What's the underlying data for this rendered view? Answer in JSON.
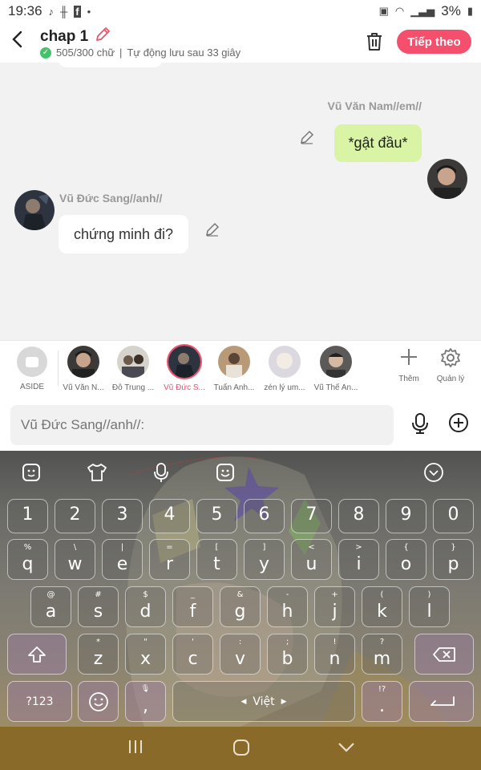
{
  "status_bar": {
    "time": "19:36",
    "battery": "3%"
  },
  "header": {
    "title": "chap 1",
    "word_count": "505/300 chữ",
    "separator": "|",
    "autosave": "Tự động lưu sau 33 giây",
    "next_label": "Tiếp theo"
  },
  "messages": [
    {
      "speaker": "Vũ Văn Nam//em//",
      "text": "*gật đầu*",
      "side": "right"
    },
    {
      "speaker": "Vũ Đức Sang//anh//",
      "text": "chứng minh đi?",
      "side": "left"
    }
  ],
  "characters": [
    {
      "label": "ASIDE"
    },
    {
      "label": "Vũ Văn N..."
    },
    {
      "label": "Đỗ Trung ..."
    },
    {
      "label": "Vũ Đức S...",
      "selected": true
    },
    {
      "label": "Tuấn Anh..."
    },
    {
      "label": "zén lý um..."
    },
    {
      "label": "Vũ Thế An..."
    }
  ],
  "tools": {
    "add_label": "Thêm",
    "manage_label": "Quản lý"
  },
  "input": {
    "placeholder": "Vũ Đức Sang//anh//:"
  },
  "keyboard": {
    "number_row": [
      "1",
      "2",
      "3",
      "4",
      "5",
      "6",
      "7",
      "8",
      "9",
      "0"
    ],
    "row1": [
      {
        "k": "q",
        "s": "%"
      },
      {
        "k": "w",
        "s": "\\"
      },
      {
        "k": "e",
        "s": "|"
      },
      {
        "k": "r",
        "s": "="
      },
      {
        "k": "t",
        "s": "["
      },
      {
        "k": "y",
        "s": "]"
      },
      {
        "k": "u",
        "s": "<"
      },
      {
        "k": "i",
        "s": ">"
      },
      {
        "k": "o",
        "s": "{"
      },
      {
        "k": "p",
        "s": "}"
      }
    ],
    "row2": [
      {
        "k": "a",
        "s": "@"
      },
      {
        "k": "s",
        "s": "#"
      },
      {
        "k": "d",
        "s": "$"
      },
      {
        "k": "f",
        "s": "_"
      },
      {
        "k": "g",
        "s": "&"
      },
      {
        "k": "h",
        "s": "-"
      },
      {
        "k": "j",
        "s": "+"
      },
      {
        "k": "k",
        "s": "("
      },
      {
        "k": "l",
        "s": ")"
      }
    ],
    "row3": [
      {
        "k": "z",
        "s": "*"
      },
      {
        "k": "x",
        "s": "\""
      },
      {
        "k": "c",
        "s": "'"
      },
      {
        "k": "v",
        "s": ":"
      },
      {
        "k": "b",
        "s": ";"
      },
      {
        "k": "n",
        "s": "!"
      },
      {
        "k": "m",
        "s": "?"
      }
    ],
    "symbols_label": "?123",
    "comma": ",",
    "space_label": "Việt",
    "period": ".",
    "period_sub": "!?"
  },
  "accent_color": "#f4506d",
  "bubble_color": "#d8f4a4",
  "icons": [
    "back-icon",
    "pencil-icon",
    "trash-icon",
    "mic-icon",
    "plus-circle-icon",
    "gear-icon",
    "sticker-icon",
    "tshirt-icon",
    "emoji-icon",
    "chevron-down-icon",
    "shift-icon",
    "backspace-icon",
    "enter-icon"
  ]
}
